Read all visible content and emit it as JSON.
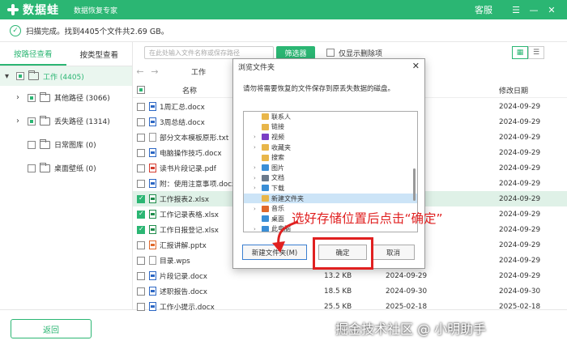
{
  "titlebar": {
    "app_name": "数据蛙",
    "subtitle": "数据恢复专家",
    "service_label": "客服",
    "menu_icon": "menu-icon",
    "minimize_icon": "minimize-icon",
    "close_icon": "close-icon",
    "brand_color": "#2bb673"
  },
  "status": {
    "text": "扫描完成。找到4405个文件共2.69 GB。"
  },
  "sidebar": {
    "tabs": [
      {
        "label": "按路径查看",
        "active": true
      },
      {
        "label": "按类型查看",
        "active": false
      }
    ],
    "root": {
      "label": "工作 (4405)"
    },
    "items": [
      {
        "label": "其他路径 (3066)"
      },
      {
        "label": "丢失路径 (1314)"
      },
      {
        "label": "日常图库 (0)"
      },
      {
        "label": "桌面壁纸 (0)"
      }
    ],
    "back_label": "返回"
  },
  "toolbar": {
    "search_placeholder": "在此处输入文件名称或保存路径",
    "filter_label": "筛选器",
    "only_deleted_label": "仅显示删除项"
  },
  "navbar": {
    "path": "工作"
  },
  "table": {
    "headers": {
      "name": "名称",
      "modified": "修改日期"
    },
    "rows": [
      {
        "name": "1周汇总.docx",
        "type": "docx",
        "size": "",
        "mod": "",
        "date": "2024-09-29",
        "checked": false,
        "selected": false
      },
      {
        "name": "3周总结.docx",
        "type": "docx",
        "size": "",
        "mod": "",
        "date": "2024-09-29",
        "checked": false,
        "selected": false
      },
      {
        "name": "部分文本模板原形.txt",
        "type": "txt",
        "size": "",
        "mod": "",
        "date": "2024-09-29",
        "checked": false,
        "selected": false
      },
      {
        "name": "电脑操作技巧.docx",
        "type": "docx",
        "size": "",
        "mod": "",
        "date": "2024-09-29",
        "checked": false,
        "selected": false
      },
      {
        "name": "读书片段记录.pdf",
        "type": "pdf",
        "size": "",
        "mod": "",
        "date": "2024-09-29",
        "checked": false,
        "selected": false
      },
      {
        "name": "附：使用注意事项.docx",
        "type": "docx",
        "size": "",
        "mod": "",
        "date": "2024-09-29",
        "checked": false,
        "selected": false
      },
      {
        "name": "工作报表2.xlsx",
        "type": "xlsx",
        "size": "",
        "mod": "",
        "date": "2024-09-29",
        "checked": true,
        "selected": true
      },
      {
        "name": "工作记录表格.xlsx",
        "type": "xlsx",
        "size": "",
        "mod": "",
        "date": "2024-09-29",
        "checked": true,
        "selected": false
      },
      {
        "name": "工作日报登记.xlsx",
        "type": "xlsx",
        "size": "",
        "mod": "",
        "date": "2024-09-29",
        "checked": true,
        "selected": false
      },
      {
        "name": "汇报讲解.pptx",
        "type": "pptx",
        "size": "",
        "mod": "",
        "date": "2024-09-29",
        "checked": false,
        "selected": false
      },
      {
        "name": "目录.wps",
        "type": "wps",
        "size": "",
        "mod": "",
        "date": "2024-09-29",
        "checked": false,
        "selected": false
      },
      {
        "name": "片段记录.docx",
        "type": "docx",
        "size": "13.2 KB",
        "mod": "2024-09-29",
        "date": "2024-09-29",
        "checked": false,
        "selected": false
      },
      {
        "name": "述职报告.docx",
        "type": "docx",
        "size": "18.5 KB",
        "mod": "2024-09-30",
        "date": "2024-09-30",
        "checked": false,
        "selected": false
      },
      {
        "name": "工作小提示.docx",
        "type": "docx",
        "size": "25.5 KB",
        "mod": "2025-02-18",
        "date": "2025-02-18",
        "checked": false,
        "selected": false
      }
    ]
  },
  "dialog": {
    "title": "浏览文件夹",
    "close_icon": "close-icon",
    "message": "请勿将需要恢复的文件保存到原丢失数据的磁盘。",
    "tree": [
      {
        "label": "联系人",
        "color": "#e8b64a",
        "chev": false
      },
      {
        "label": "链接",
        "color": "#e8b64a",
        "chev": false
      },
      {
        "label": "视频",
        "color": "#7b3fc4",
        "chev": true
      },
      {
        "label": "收藏夹",
        "color": "#e8b64a",
        "chev": true
      },
      {
        "label": "搜索",
        "color": "#e8b64a",
        "chev": false
      },
      {
        "label": "图片",
        "color": "#3a8ed6",
        "chev": true
      },
      {
        "label": "文档",
        "color": "#6b7a8c",
        "chev": true
      },
      {
        "label": "下载",
        "color": "#3a8ed6",
        "chev": true
      },
      {
        "label": "新建文件夹",
        "color": "#e8b64a",
        "chev": false,
        "highlight": true
      },
      {
        "label": "音乐",
        "color": "#e0682b",
        "chev": true
      },
      {
        "label": "桌面",
        "color": "#3a8ed6",
        "chev": false
      },
      {
        "label": "此电脑",
        "color": "#3a8ed6",
        "chev": true
      }
    ],
    "new_folder_label": "新建文件夹(M)",
    "ok_label": "确定",
    "cancel_label": "取消"
  },
  "annotation": {
    "text": "选好存储位置后点击“确定”",
    "color": "#e02020"
  },
  "watermark": {
    "text": "掘金技术社区 @ 小明助手"
  }
}
